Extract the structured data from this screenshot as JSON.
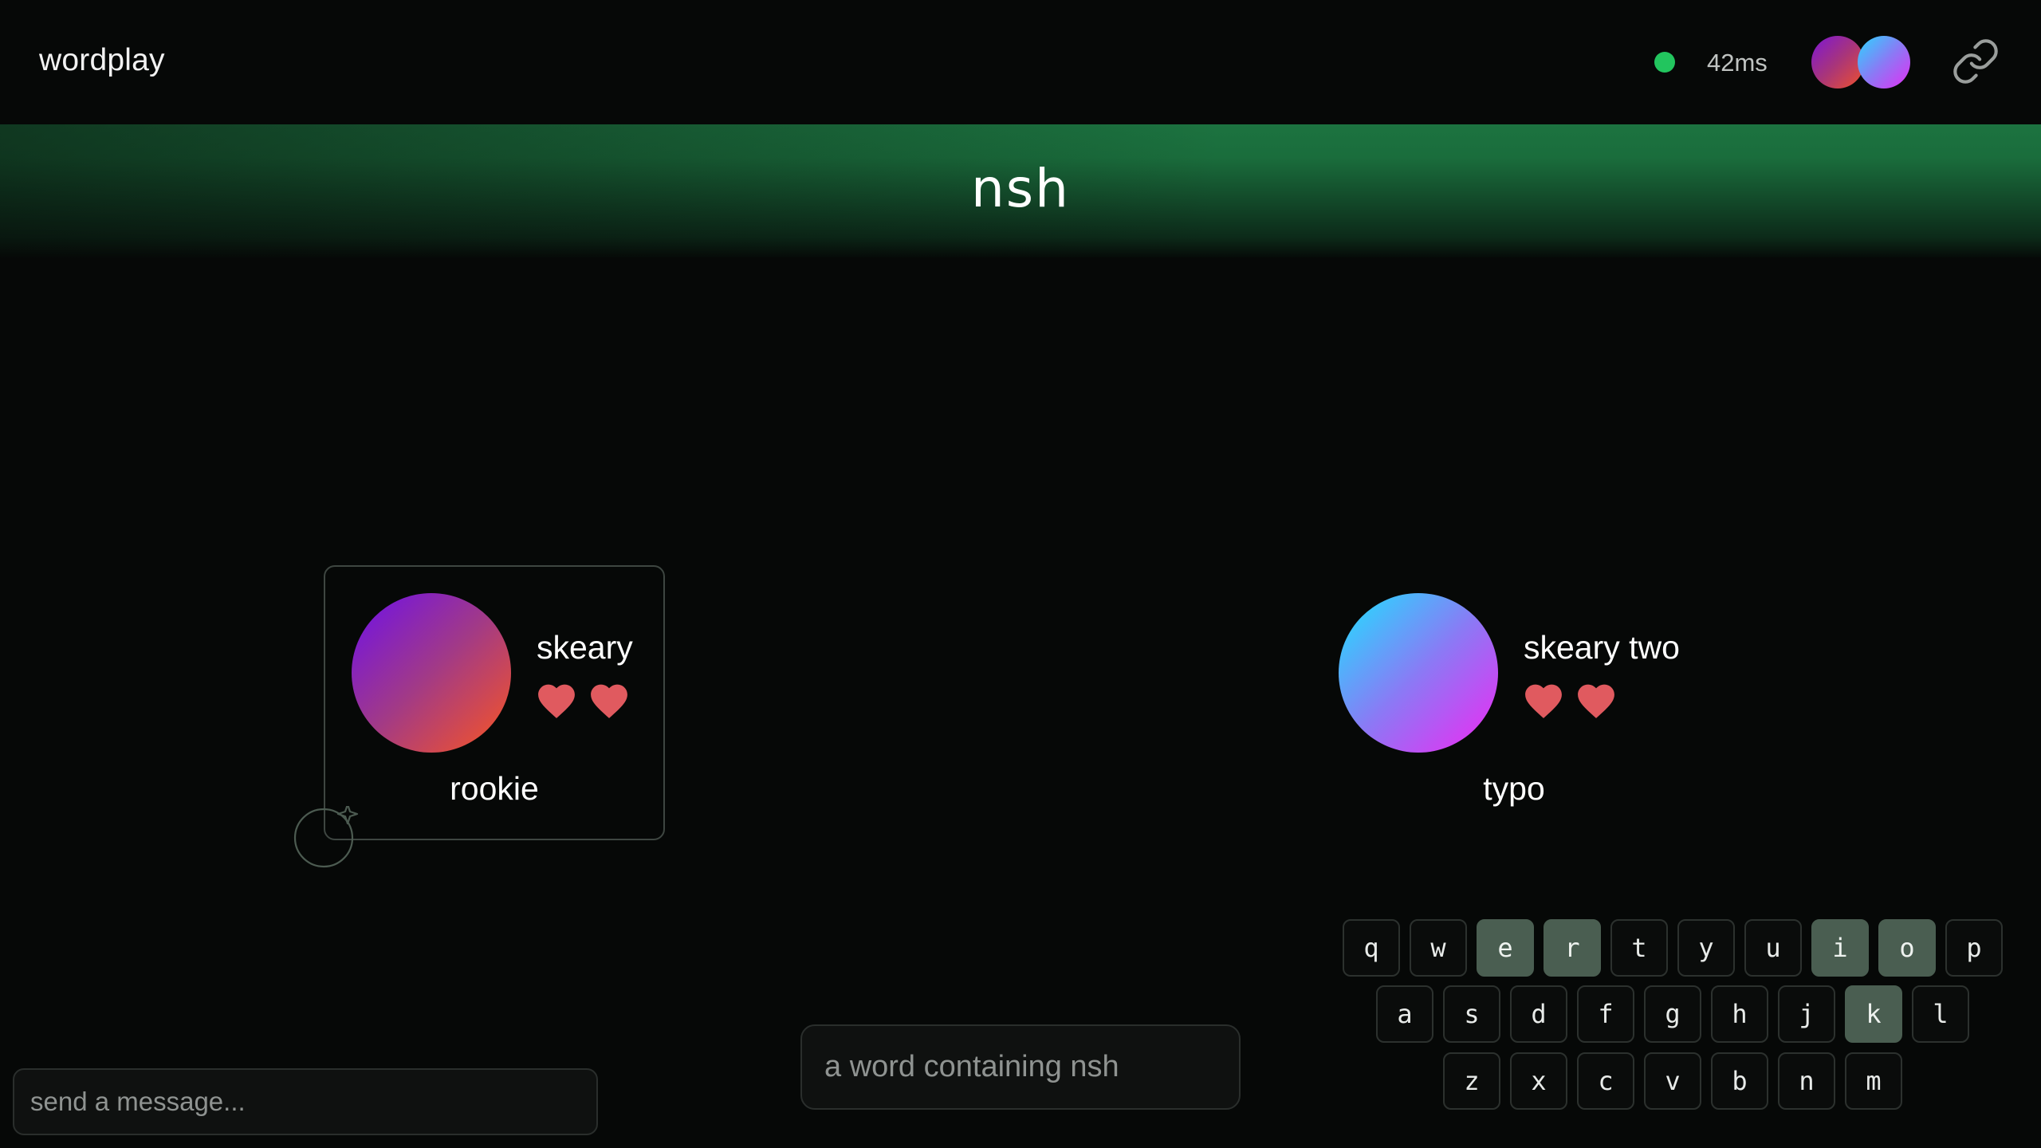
{
  "header": {
    "app_name": "wordplay",
    "latency": "42ms",
    "connection_color": "#22c55e",
    "link_icon": "link-icon"
  },
  "prompt": {
    "letters": "nsh"
  },
  "players": [
    {
      "name": "skeary",
      "title": "rookie",
      "lives": 2,
      "active": true,
      "avatar_colors": [
        "#7314e0",
        "#f2532a"
      ]
    },
    {
      "name": "skeary two",
      "title": "typo",
      "lives": 2,
      "active": false,
      "avatar_colors": [
        "#27d9ff",
        "#e630f2"
      ]
    }
  ],
  "word_input": {
    "placeholder": "a word containing nsh",
    "value": ""
  },
  "chat_input": {
    "placeholder": "send a message...",
    "value": ""
  },
  "keyboard": {
    "rows": [
      [
        "q",
        "w",
        "e",
        "r",
        "t",
        "y",
        "u",
        "i",
        "o",
        "p"
      ],
      [
        "a",
        "s",
        "d",
        "f",
        "g",
        "h",
        "j",
        "k",
        "l"
      ],
      [
        "z",
        "x",
        "c",
        "v",
        "b",
        "n",
        "m"
      ]
    ],
    "used": [
      "e",
      "r",
      "i",
      "o",
      "k"
    ]
  },
  "colors": {
    "heart": "#e05a5f",
    "used_key": "#4a5e51",
    "banner": "#1c7340"
  }
}
